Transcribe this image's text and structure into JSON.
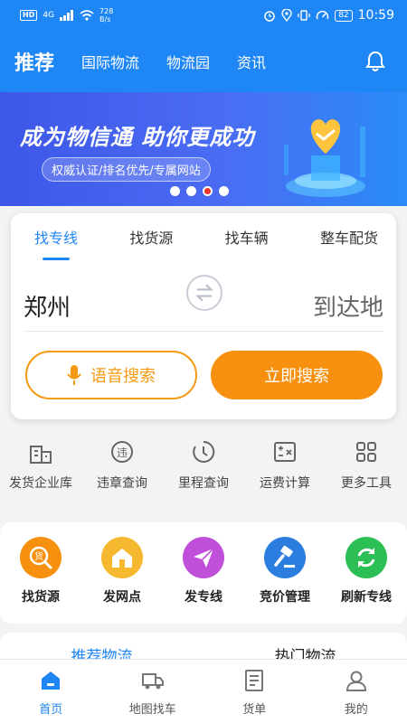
{
  "status_bar": {
    "network": "HD",
    "signal": "4G",
    "speed_value": "728",
    "speed_unit": "B/s",
    "battery": "82",
    "time": "10:59"
  },
  "nav": {
    "title": "推荐",
    "tabs": [
      "国际物流",
      "物流园",
      "资讯"
    ],
    "bell_icon": "bell-icon"
  },
  "banner": {
    "headline": "成为物信通 助你更成功",
    "subtitle": "权威认证/排名优先/专属网站",
    "active_dot": 3,
    "dot_count": 4
  },
  "search_card": {
    "tabs": [
      "找专线",
      "找货源",
      "找车辆",
      "整车配货"
    ],
    "active_tab": 0,
    "from": "郑州",
    "to": "到达地",
    "voice_button": "语音搜索",
    "search_button": "立即搜索"
  },
  "tools": [
    {
      "label": "发货企业库",
      "icon": "company-icon"
    },
    {
      "label": "违章查询",
      "icon": "violation-icon"
    },
    {
      "label": "里程查询",
      "icon": "mileage-icon"
    },
    {
      "label": "运费计算",
      "icon": "calculator-icon"
    },
    {
      "label": "更多工具",
      "icon": "grid-icon"
    }
  ],
  "features": [
    {
      "label": "找货源",
      "icon": "find-goods-icon",
      "color": "#f7900e"
    },
    {
      "label": "发网点",
      "icon": "house-icon",
      "color": "#f5b82e"
    },
    {
      "label": "发专线",
      "icon": "send-icon",
      "color": "#c04fd9"
    },
    {
      "label": "竞价管理",
      "icon": "gavel-icon",
      "color": "#2b7de0"
    },
    {
      "label": "刷新专线",
      "icon": "refresh-icon",
      "color": "#2bbf55"
    }
  ],
  "sections": [
    "推荐物流",
    "热门物流"
  ],
  "tabbar": [
    {
      "label": "首页",
      "icon": "home-icon"
    },
    {
      "label": "地图找车",
      "icon": "truck-icon"
    },
    {
      "label": "货单",
      "icon": "document-icon"
    },
    {
      "label": "我的",
      "icon": "user-icon"
    }
  ],
  "colors": {
    "primary": "#1f86f5",
    "orange": "#f7900e"
  }
}
